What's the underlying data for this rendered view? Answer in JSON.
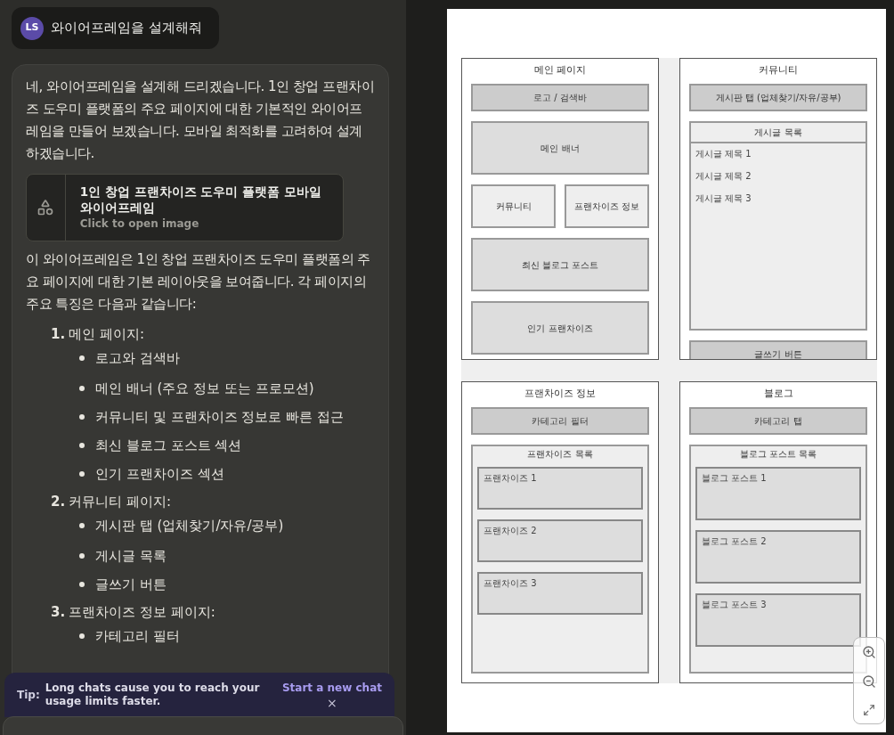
{
  "user_message": {
    "avatar": "LS",
    "text": "와이어프레임을 설계해줘"
  },
  "assistant_message": {
    "intro": "네, 와이어프레임을 설계해 드리겠습니다. 1인 창업 프랜차이즈 도우미 플랫폼의 주요 페이지에 대한 기본적인 와이어프레임을 만들어 보겠습니다. 모바일 최적화를 고려하여 설계하겠습니다.",
    "artifact": {
      "title": "1인 창업 프랜차이즈 도우미 플랫폼 모바일 와이어프레임",
      "subtitle": "Click to open image"
    },
    "summary": "이 와이어프레임은 1인 창업 프랜차이즈 도우미 플랫폼의 주요 페이지에 대한 기본 레이아웃을 보여줍니다. 각 페이지의 주요 특징은 다음과 같습니다:",
    "sections": [
      {
        "number": "1.",
        "title": "메인 페이지:",
        "bullets": [
          "로고와 검색바",
          "메인 배너 (주요 정보 또는 프로모션)",
          "커뮤니티 및 프랜차이즈 정보로 빠른 접근",
          "최신 블로그 포스트 섹션",
          "인기 프랜차이즈 섹션"
        ]
      },
      {
        "number": "2.",
        "title": "커뮤니티 페이지:",
        "bullets": [
          "게시판 탭 (업체찾기/자유/공부)",
          "게시글 목록",
          "글쓰기 버튼"
        ]
      },
      {
        "number": "3.",
        "title": "프랜차이즈 정보 페이지:",
        "bullets": [
          "카테고리 필터"
        ]
      }
    ]
  },
  "tip": {
    "label": "Tip:",
    "text": "Long chats cause you to reach your usage limits faster.",
    "link": "Start a new chat",
    "close": "×"
  },
  "wireframe": {
    "pages": [
      {
        "title": "메인 페이지",
        "blocks": [
          {
            "kind": "bar",
            "label": "로고 / 검색바"
          },
          {
            "kind": "box",
            "label": "메인 배너"
          },
          {
            "kind": "pair",
            "labels": [
              "커뮤니티",
              "프랜차이즈 정보"
            ]
          },
          {
            "kind": "box",
            "label": "최신 블로그 포스트"
          },
          {
            "kind": "box",
            "label": "인기 프랜차이즈"
          }
        ]
      },
      {
        "title": "커뮤니티",
        "blocks": [
          {
            "kind": "bar",
            "label": "게시판 탭 (업체찾기/자유/공부)"
          },
          {
            "kind": "text_list",
            "label": "게시글 목록",
            "items": [
              "게시글 제목 1",
              "게시글 제목 2",
              "게시글 제목 3"
            ]
          },
          {
            "kind": "bar",
            "label": "글쓰기 버튼"
          }
        ]
      },
      {
        "title": "프랜차이즈 정보",
        "blocks": [
          {
            "kind": "bar",
            "label": "카테고리 필터"
          },
          {
            "kind": "card_list",
            "label": "프랜차이즈 목록",
            "items": [
              "프랜차이즈 1",
              "프랜차이즈 2",
              "프랜차이즈 3"
            ]
          }
        ]
      },
      {
        "title": "블로그",
        "blocks": [
          {
            "kind": "bar",
            "label": "카테고리 탭"
          },
          {
            "kind": "card_list",
            "label": "블로그 포스트 목록",
            "items": [
              "블로그 포스트 1",
              "블로그 포스트 2",
              "블로그 포스트 3"
            ]
          }
        ]
      }
    ]
  }
}
